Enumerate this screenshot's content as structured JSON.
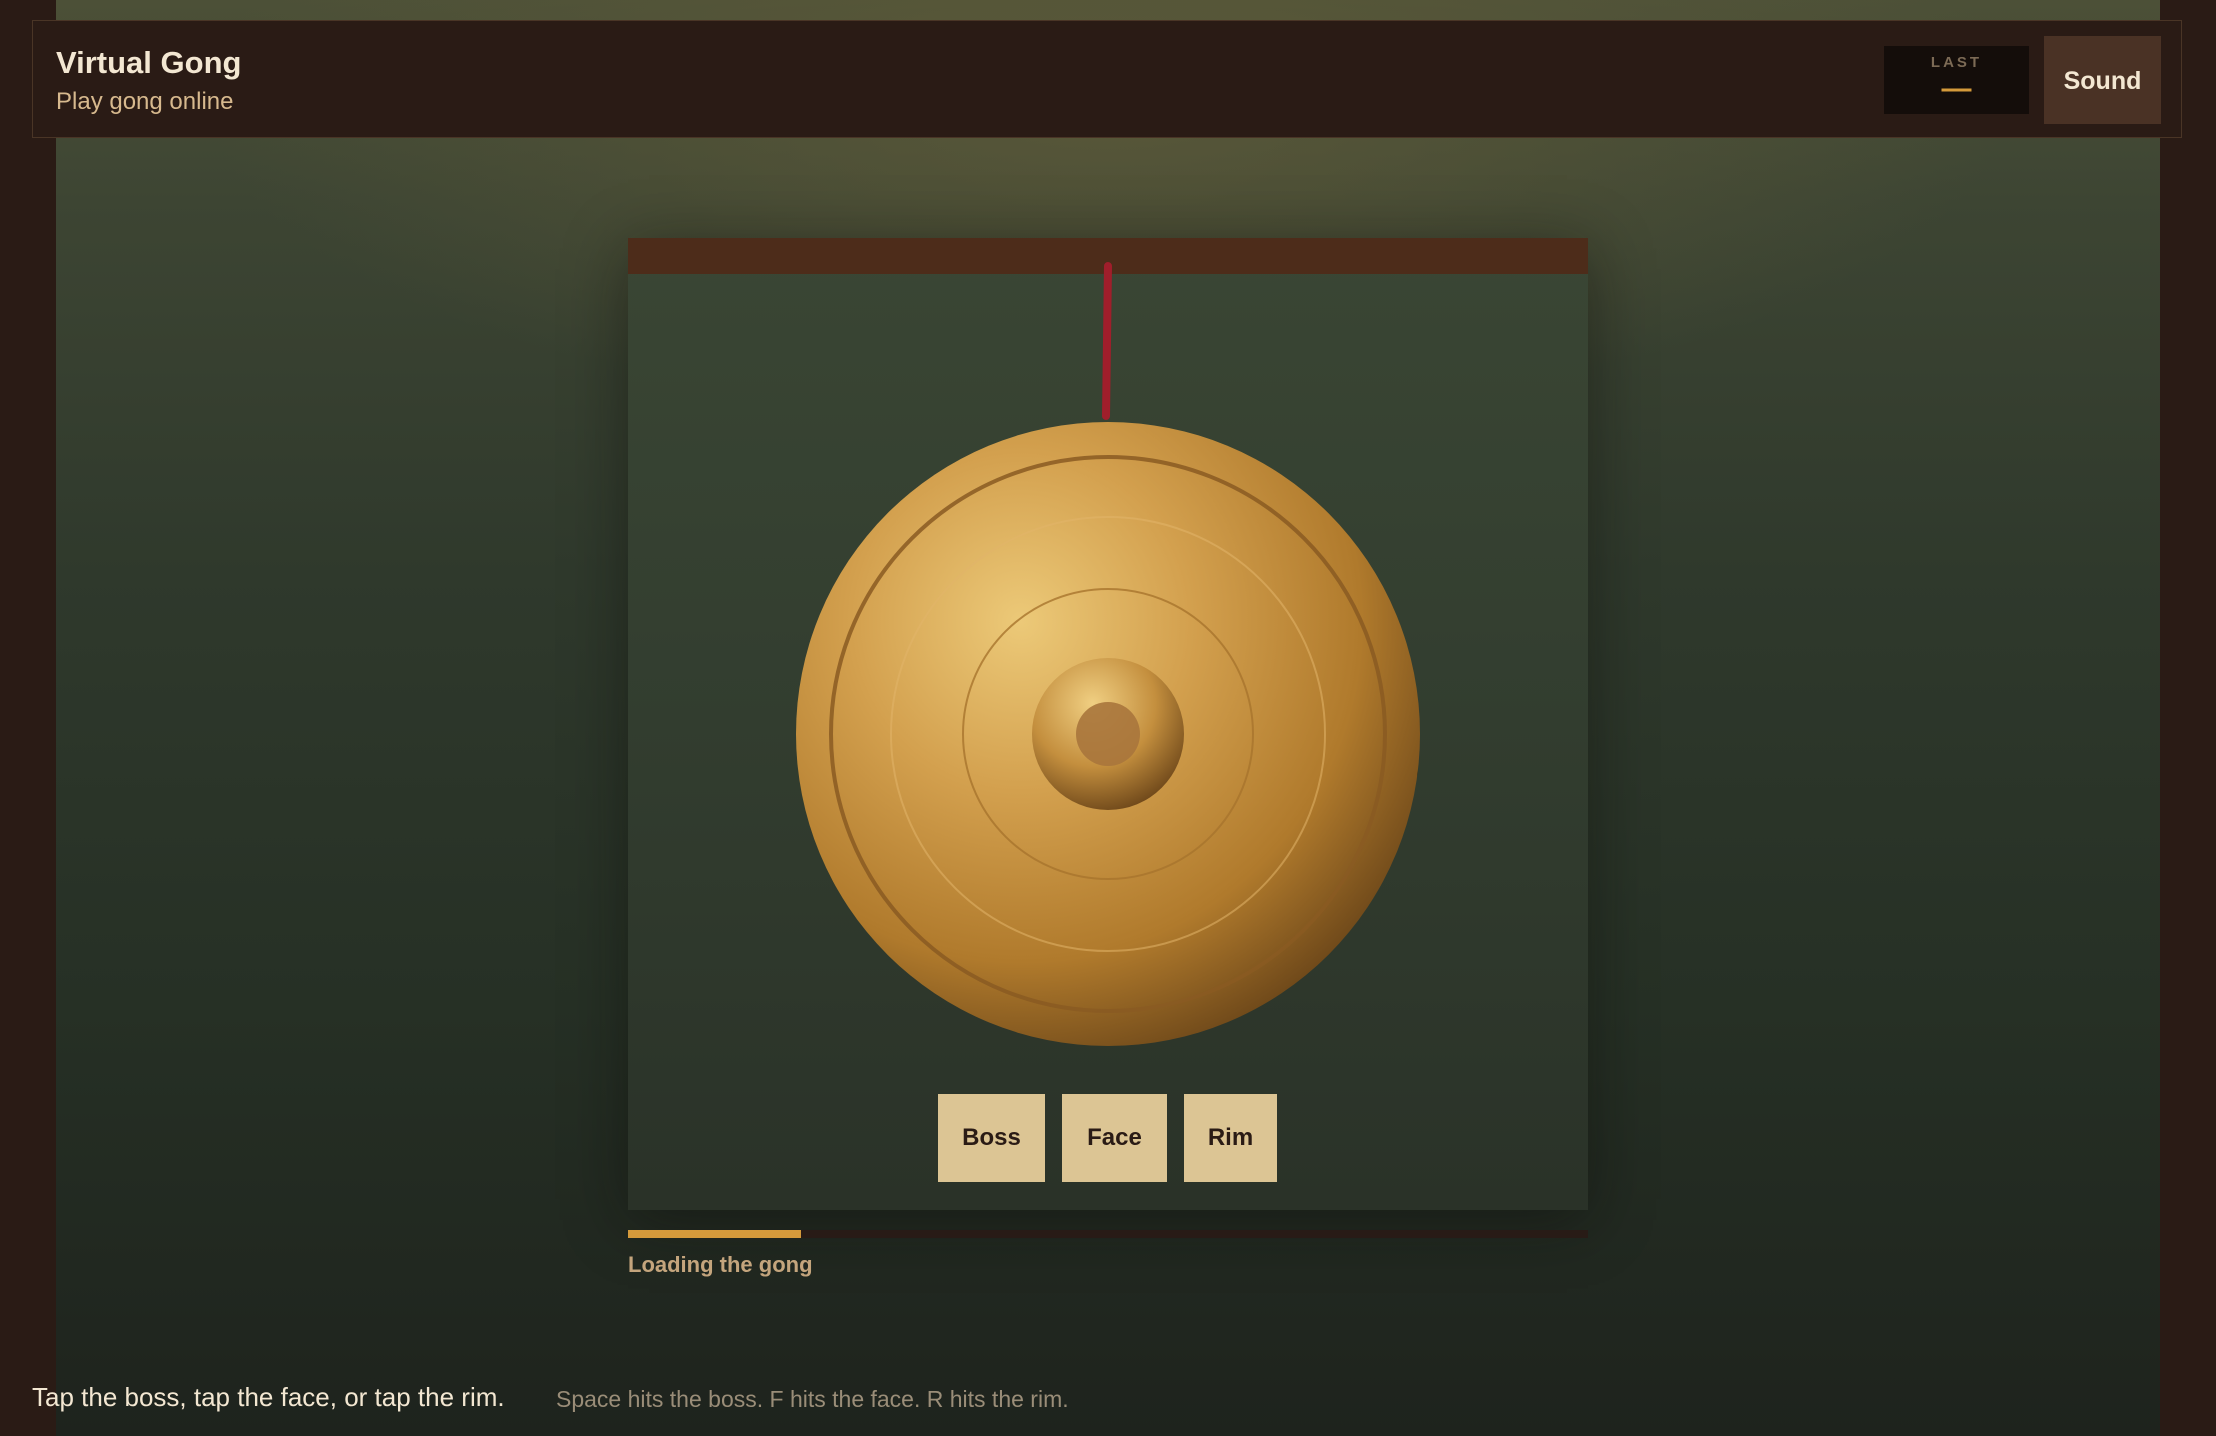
{
  "header": {
    "title": "Virtual Gong",
    "subtitle": "Play gong online",
    "last": {
      "label": "LAST",
      "value": "—"
    },
    "sound_button": "Sound"
  },
  "gong": {
    "strike_buttons": [
      {
        "label": "Boss"
      },
      {
        "label": "Face"
      },
      {
        "label": "Rim"
      }
    ]
  },
  "loading": {
    "text": "Loading the gong",
    "progress": 0.18
  },
  "hints": {
    "primary": "Tap the boss, tap the face, or tap the rim.",
    "keyboard": "Space hits the boss. F hits the face. R hits the rim."
  },
  "colors": {
    "accent": "#d59a3b",
    "header_bg": "#2a1b15",
    "button_bg": "#dcc594",
    "cord": "#a01e2b"
  }
}
